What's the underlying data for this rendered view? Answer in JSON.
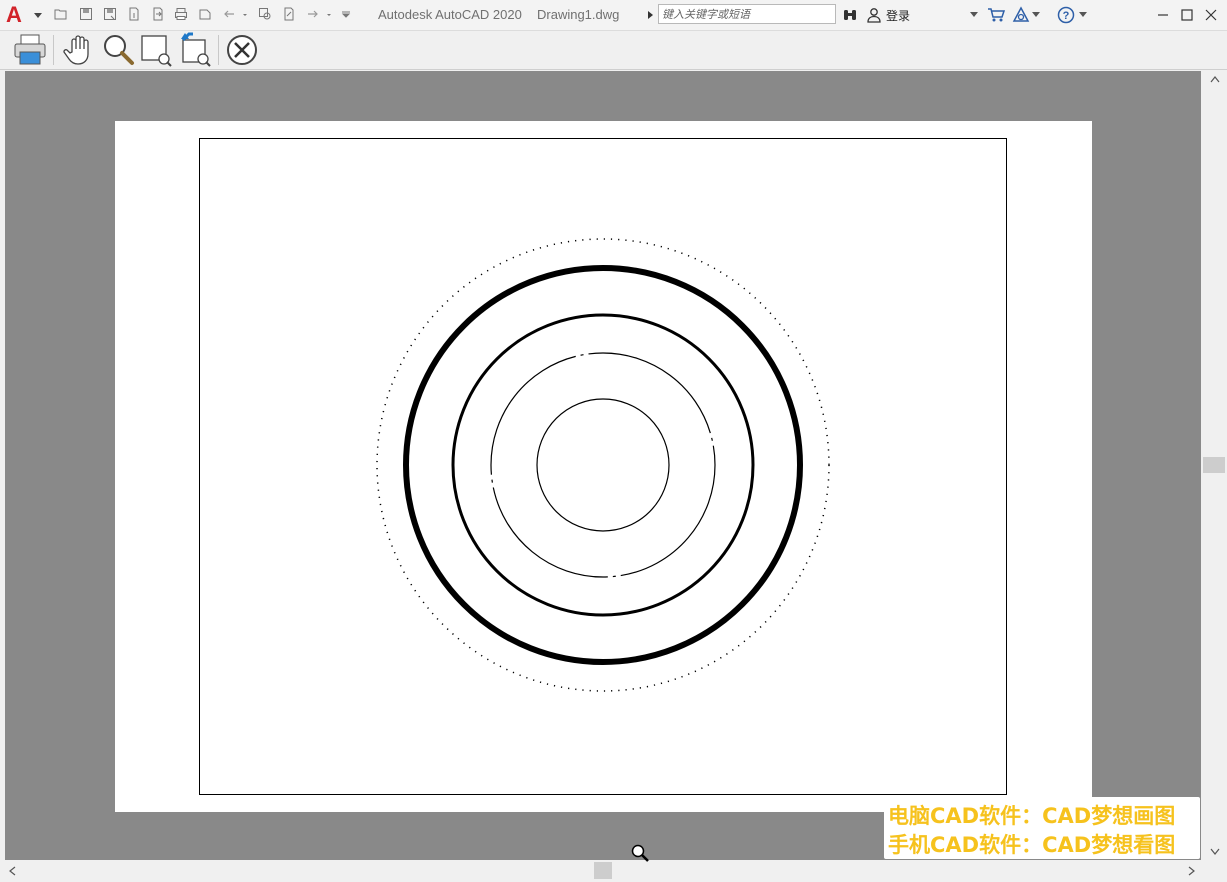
{
  "titlebar": {
    "app_letter": "A",
    "app_name": "Autodesk AutoCAD 2020",
    "file_name": "Drawing1.dwg",
    "search_placeholder": "键入关键字或短语",
    "login_label": "登录",
    "qat_icons": [
      "open-icon",
      "save-icon",
      "save-as-icon",
      "publish-icon",
      "export-icon",
      "plot-icon",
      "blank-icon",
      "undo-icon",
      "undo-dropdown-icon",
      "find-icon",
      "share-icon",
      "redo-icon",
      "redo-dropdown-icon",
      "customize-qat-icon"
    ]
  },
  "toolbar": {
    "buttons": [
      "print-icon",
      "pan-hand-icon",
      "zoom-icon",
      "zoom-window-icon",
      "zoom-previous-icon",
      "close-preview-icon"
    ]
  },
  "drawing": {
    "type": "plot-preview",
    "elements": [
      "outer-dotted-circle",
      "thick-circle",
      "medium-circle",
      "center-line-circle",
      "inner-circle",
      "drawing-border-rectangle"
    ]
  },
  "watermark": {
    "line1": "电脑CAD软件：CAD梦想画图",
    "line2": "手机CAD软件：CAD梦想看图",
    "color": "#f6c21d"
  },
  "colors": {
    "viewport_bg": "#898989",
    "paper": "#ffffff",
    "app_red": "#d2232a"
  }
}
